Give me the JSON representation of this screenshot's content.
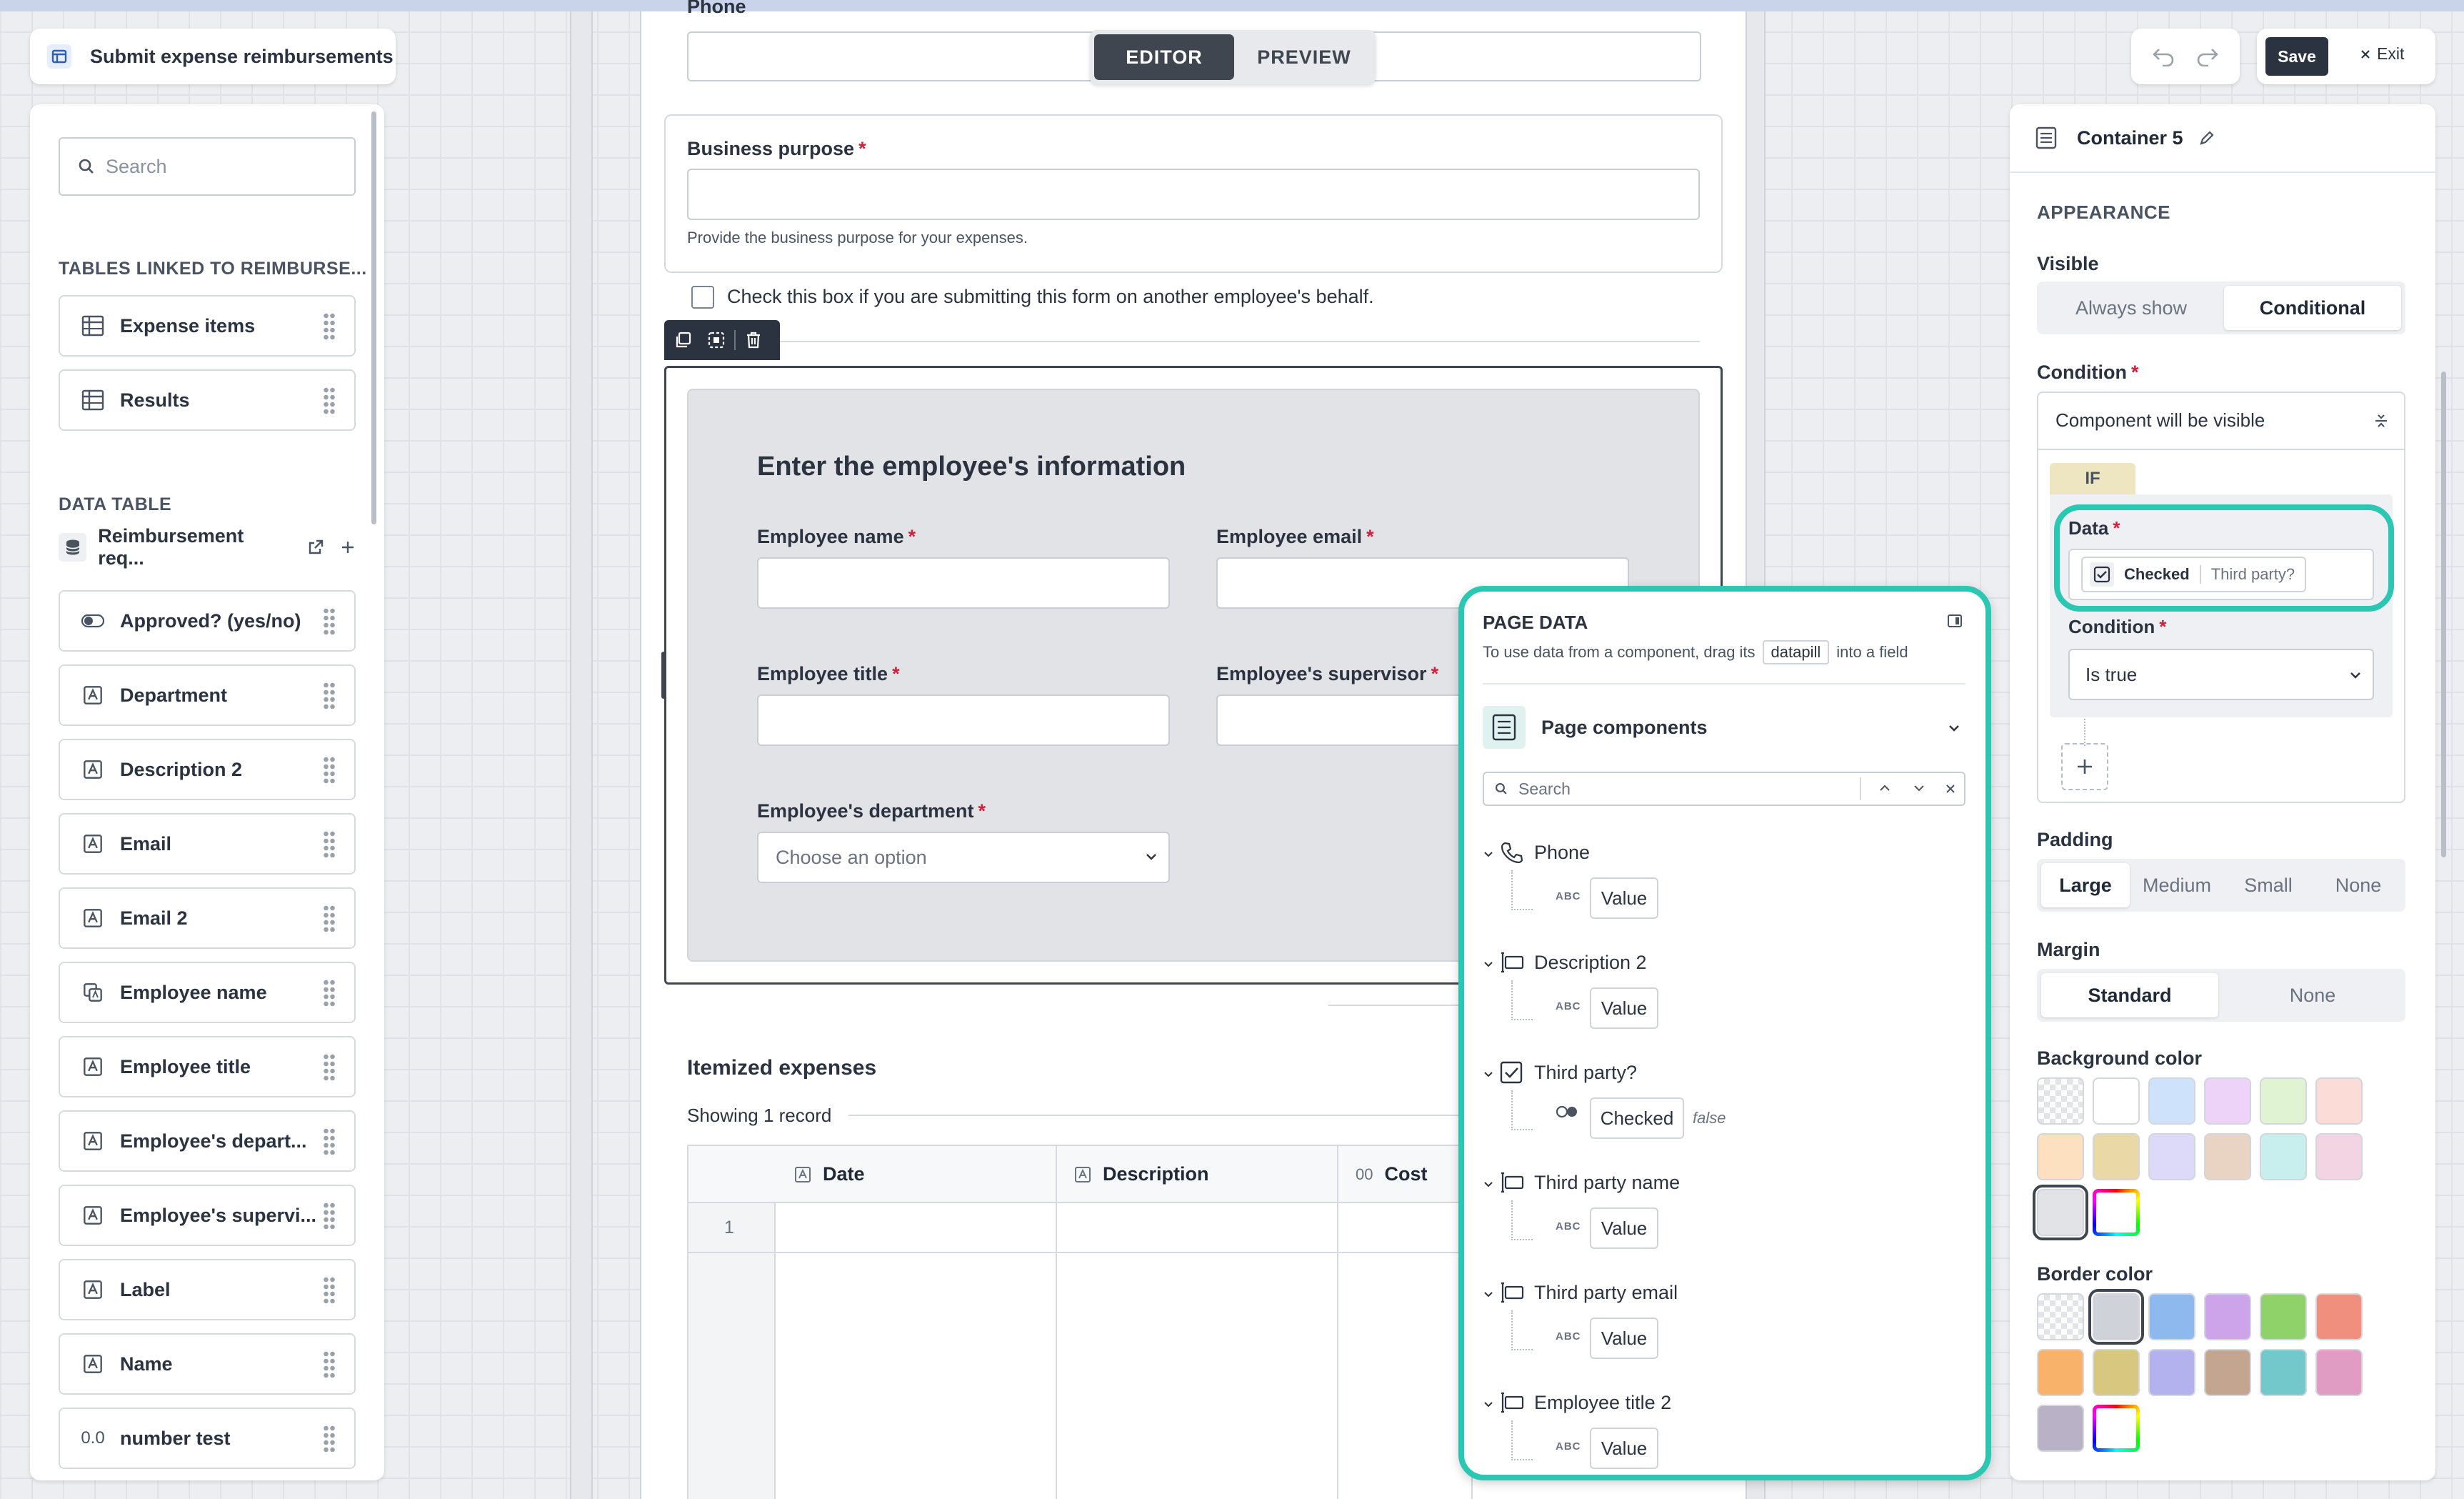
{
  "app": {
    "title": "Submit expense reimbursements"
  },
  "mode_tabs": {
    "editor": "EDITOR",
    "preview": "PREVIEW"
  },
  "toolbar": {
    "save": "Save",
    "exit": "Exit"
  },
  "left_panel": {
    "search_placeholder": "Search",
    "linked_title": "TABLES LINKED TO REIMBURSE...",
    "linked": [
      {
        "label": "Expense items"
      },
      {
        "label": "Results"
      }
    ],
    "data_table_title": "DATA TABLE",
    "data_table_name": "Reimbursement req...",
    "fields": [
      {
        "label": "Approved? (yes/no)",
        "icon": "toggle-icon"
      },
      {
        "label": "Department",
        "icon": "text-field-icon"
      },
      {
        "label": "Description 2",
        "icon": "text-field-icon"
      },
      {
        "label": "Email",
        "icon": "text-field-icon"
      },
      {
        "label": "Email 2",
        "icon": "text-field-icon"
      },
      {
        "label": "Employee name",
        "icon": "lookup-field-icon"
      },
      {
        "label": "Employee title",
        "icon": "text-field-icon"
      },
      {
        "label": "Employee's depart...",
        "icon": "text-field-icon"
      },
      {
        "label": "Employee's supervi...",
        "icon": "text-field-icon"
      },
      {
        "label": "Label",
        "icon": "text-field-icon"
      },
      {
        "label": "Name",
        "icon": "text-field-icon"
      },
      {
        "label": "number test",
        "icon": "number-field-icon"
      }
    ]
  },
  "form": {
    "phone_label": "Phone",
    "business_purpose": {
      "label": "Business purpose",
      "hint": "Provide the business purpose for your expenses."
    },
    "third_party_checkbox": "Check this box if you are submitting this form on another employee's behalf.",
    "container": {
      "heading": "Enter the employee's information",
      "employee_name": "Employee name",
      "employee_email": "Employee email",
      "employee_title": "Employee title",
      "employee_supervisor": "Employee's supervisor",
      "employee_department": "Employee's department",
      "department_placeholder": "Choose an option"
    },
    "itemized": {
      "title": "Itemized expenses",
      "showing": "Showing 1 record",
      "columns": [
        "Date",
        "Description",
        "Cost"
      ],
      "row_number": "1"
    }
  },
  "page_data_panel": {
    "title": "PAGE DATA",
    "desc_before": "To use data from a component, drag its",
    "desc_pill": "datapill",
    "desc_after": "into a field",
    "section": "Page components",
    "search_placeholder": "Search",
    "items": [
      {
        "name": "Phone",
        "icon": "phone-icon",
        "chip": "Value",
        "type": "ABC"
      },
      {
        "name": "Description 2",
        "icon": "input-field-icon",
        "chip": "Value",
        "type": "ABC"
      },
      {
        "name": "Third party?",
        "icon": "checkbox-icon",
        "chip": "Checked",
        "extra": "false",
        "type": "toggle"
      },
      {
        "name": "Third party name",
        "icon": "input-field-icon",
        "chip": "Value",
        "type": "ABC"
      },
      {
        "name": "Third party email",
        "icon": "input-field-icon",
        "chip": "Value",
        "type": "ABC"
      },
      {
        "name": "Employee title 2",
        "icon": "input-field-icon",
        "chip": "Value",
        "type": "ABC"
      }
    ]
  },
  "right_panel": {
    "component_name": "Container 5",
    "appearance": "APPEARANCE",
    "visible": {
      "label": "Visible",
      "options": [
        "Always show",
        "Conditional"
      ],
      "selected": "Conditional"
    },
    "condition": {
      "label": "Condition",
      "summary": "Component will be visible",
      "if": "IF",
      "data_label": "Data",
      "pill_main": "Checked",
      "pill_source": "Third party?",
      "cond_label": "Condition",
      "cond_value": "Is true"
    },
    "padding": {
      "label": "Padding",
      "options": [
        "Large",
        "Medium",
        "Small",
        "None"
      ],
      "selected": "Large"
    },
    "margin": {
      "label": "Margin",
      "options": [
        "Standard",
        "None"
      ],
      "selected": "Standard"
    },
    "background_color": {
      "label": "Background color",
      "swatches": [
        "transparent",
        "#ffffff",
        "#cfe2fb",
        "#ecd3f7",
        "#e0f4d4",
        "#fbdcd6",
        "#fde0c0",
        "#ead9a6",
        "#dcdaf8",
        "#e9d4c3",
        "#c9eeee",
        "#f2d4e3",
        "#e2e3e7",
        "custom"
      ],
      "selected": "#e2e3e7"
    },
    "border_color": {
      "label": "Border color",
      "swatches": [
        "transparent",
        "#cfd3d9",
        "#8eb9ef",
        "#cda3ea",
        "#8fd26a",
        "#f08f7d",
        "#f8b26a",
        "#d8c77f",
        "#b4b2ee",
        "#c3a590",
        "#72c8cb",
        "#e19cc3",
        "#b9b2c7",
        "custom"
      ],
      "selected": "#cfd3d9"
    }
  }
}
